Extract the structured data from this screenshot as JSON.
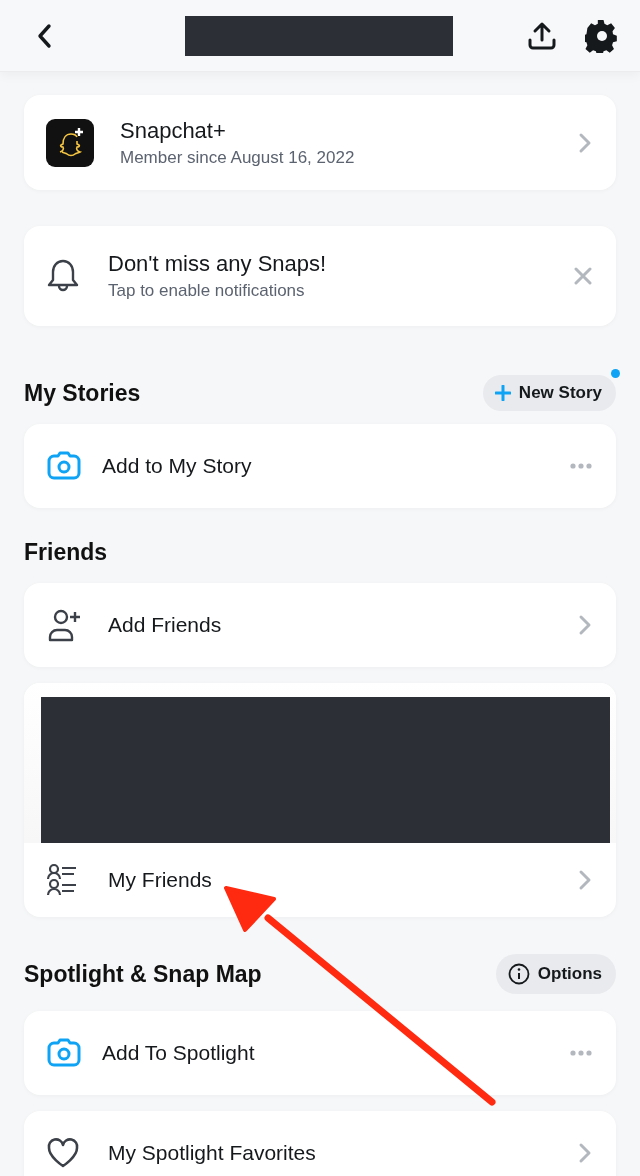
{
  "header": {
    "title_redacted": true
  },
  "top_cards": [
    {
      "kind": "subscription",
      "title": "Snapchat+",
      "subtitle": "Member since August 16, 2022",
      "accessory": {
        "kind": "chevron"
      }
    },
    {
      "kind": "notice",
      "title": "Don't miss any Snaps!",
      "subtitle": "Tap to enable notifications",
      "accessory": {
        "kind": "close"
      }
    }
  ],
  "sections": [
    {
      "title": "My Stories",
      "button": {
        "kind": "add",
        "label": "New Story",
        "dot": true
      },
      "items": [
        {
          "kind": "camera",
          "label": "Add to My Story",
          "accessory": {
            "kind": "more"
          }
        }
      ]
    },
    {
      "title": "Friends",
      "items": [
        {
          "kind": "add-friends",
          "label": "Add Friends",
          "accessory": {
            "kind": "chevron"
          }
        },
        {
          "kind": "friends-list",
          "label": "My Friends",
          "accessory": {
            "kind": "chevron"
          },
          "preview_redacted": true
        }
      ]
    },
    {
      "title": "Spotlight & Snap Map",
      "button": {
        "kind": "info",
        "label": "Options",
        "dot": false
      },
      "items": [
        {
          "kind": "camera",
          "label": "Add To Spotlight",
          "accessory": {
            "kind": "more"
          }
        },
        {
          "kind": "heart",
          "label": "My Spotlight Favorites",
          "accessory": {
            "kind": "chevron"
          }
        }
      ]
    }
  ],
  "annotations": [
    {
      "kind": "arrow"
    }
  ]
}
